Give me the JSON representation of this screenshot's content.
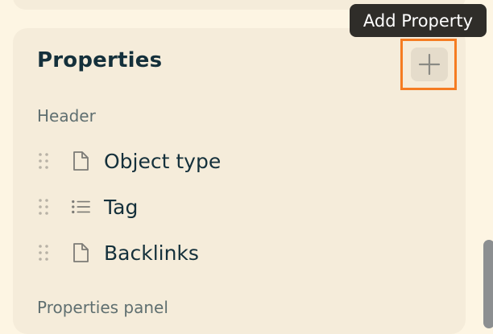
{
  "properties": {
    "title": "Properties",
    "add_button_tooltip": "Add Property",
    "sections": [
      {
        "label": "Header",
        "items": [
          {
            "label": "Object type",
            "icon": "document-icon"
          },
          {
            "label": "Tag",
            "icon": "list-icon"
          },
          {
            "label": "Backlinks",
            "icon": "document-icon"
          }
        ]
      },
      {
        "label": "Properties panel",
        "items": []
      }
    ]
  },
  "colors": {
    "page_background": "#fdf5e3",
    "card_background": "#f5ecda",
    "highlight": "#f57c22",
    "tooltip_background": "#2f2d29",
    "text": "#14303b",
    "muted_text": "#5f6f70"
  }
}
